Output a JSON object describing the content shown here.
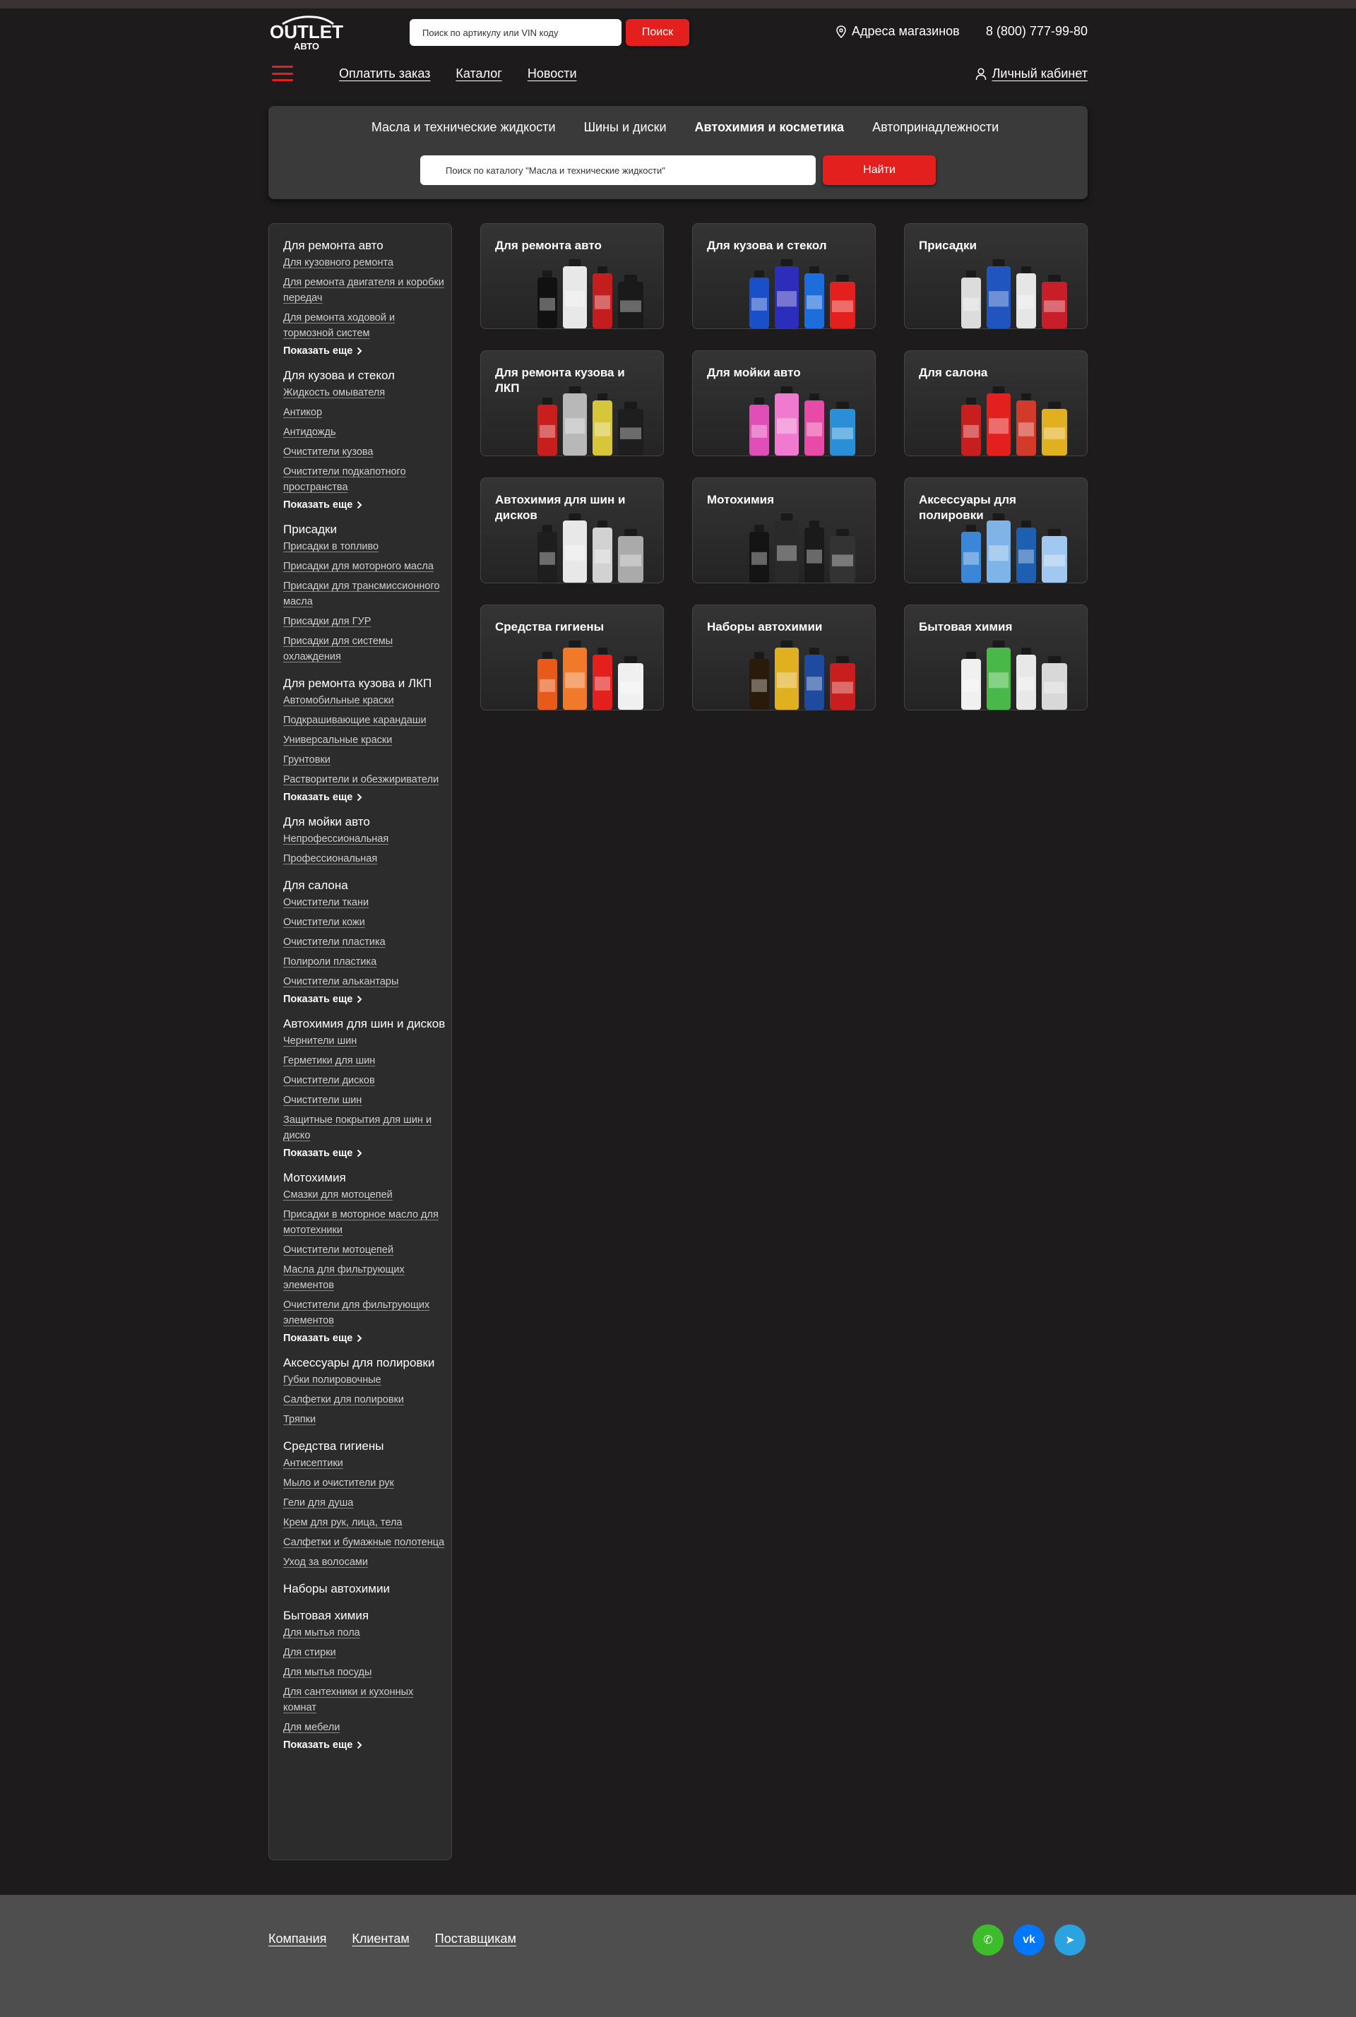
{
  "colors": {
    "accent": "#e4201f",
    "bg": "#1d1b1c",
    "panel": "#3a3a3b",
    "footer": "#4e4e4f",
    "whatsapp": "#3ebd2b",
    "vk": "#0077ff",
    "telegram": "#2aa3e0"
  },
  "header": {
    "logo_top": "OUTLET",
    "logo_bottom": "АВТО",
    "search_placeholder": "Поиск по артикулу или VIN коду",
    "search_button": "Поиск",
    "stores": "Адреса магазинов",
    "phone": "8 (800) 777-99-80"
  },
  "nav": {
    "links": [
      "Оплатить заказ",
      "Каталог",
      "Новости"
    ],
    "cabinet": "Личный кабинет"
  },
  "catalog": {
    "tabs": [
      "Масла и технические жидкости",
      "Шины и диски",
      "Автохимия и косметика",
      "Автопринадлежности"
    ],
    "active_tab": 2,
    "search_placeholder": "Поиск по каталогу \"Масла и технические жидкости\"",
    "search_button": "Найти"
  },
  "sidebar": {
    "show_more": "Показать еще",
    "groups": [
      {
        "title": "Для ремонта авто",
        "links": [
          "Для кузовного ремонта",
          "Для ремонта двигателя и коробки передач",
          "Для ремонта ходовой и тормозной систем"
        ],
        "more": true
      },
      {
        "title": "Для кузова и стекол",
        "links": [
          "Жидкость омывателя",
          "Антикор",
          "Антидождь",
          "Очистители кузова",
          "Очистители подкапотного пространства"
        ],
        "more": true
      },
      {
        "title": "Присадки",
        "links": [
          "Присадки в топливо",
          "Присадки для моторного масла",
          "Присадки для трансмиссионного масла",
          "Присадки для ГУР",
          "Присадки для системы охлаждения"
        ],
        "more": false
      },
      {
        "title": "Для ремонта кузова и ЛКП",
        "links": [
          "Автомобильные краски",
          "Подкрашивающие карандаши",
          "Универсальные краски",
          "Грунтовки",
          "Растворители и обезжириватели"
        ],
        "more": true
      },
      {
        "title": "Для мойки авто",
        "links": [
          "Непрофессиональная",
          "Профессиональная"
        ],
        "more": false
      },
      {
        "title": "Для салона",
        "links": [
          "Очистители ткани",
          "Очистители кожи",
          "Очистители пластика",
          "Полироли пластика",
          "Очистители алькантары"
        ],
        "more": true
      },
      {
        "title": "Автохимия для шин и дисков",
        "links": [
          "Чернители шин",
          "Герметики для шин",
          "Очистители дисков",
          "Очистители шин",
          "Защитные покрытия для шин и диско"
        ],
        "more": true
      },
      {
        "title": "Мотохимия",
        "links": [
          "Смазки для мотоцепей",
          "Присадки в моторное масло для мототехники",
          "Очистители мотоцепей",
          "Масла для фильтрующих элементов",
          "Очистители для фильтрующих элементов"
        ],
        "more": true
      },
      {
        "title": "Аксессуары для полировки",
        "links": [
          "Губки полировочные",
          "Салфетки для полировки",
          "Тряпки"
        ],
        "more": false
      },
      {
        "title": "Средства гигиены",
        "links": [
          "Антисептики",
          "Мыло и очистители рук",
          "Гели для душа",
          "Крем для рук, лица, тела",
          "Салфетки и бумажные полотенца",
          "Уход за волосами"
        ],
        "more": false
      },
      {
        "title": "Наборы автохимии",
        "links": [],
        "more": false
      },
      {
        "title": "Бытовая химия",
        "links": [
          "Для мытья пола",
          "Для стирки",
          "Для мытья посуды",
          "Для сантехники и кухонных комнат",
          "Для мебели"
        ],
        "more": true
      }
    ]
  },
  "cards": [
    {
      "title": "Для ремонта авто",
      "palette": [
        "#111111",
        "#e8e8e8",
        "#c41d1d",
        "#1a1a1a"
      ]
    },
    {
      "title": "Для кузова и стекол",
      "palette": [
        "#1b4fc8",
        "#2d2dbb",
        "#1e6ddc",
        "#e4201f"
      ]
    },
    {
      "title": "Присадки",
      "palette": [
        "#dcdcdc",
        "#2055c0",
        "#e6e6e6",
        "#c81e2a"
      ]
    },
    {
      "title": "Для ремонта кузова и ЛКП",
      "palette": [
        "#c81e1e",
        "#b8b8b8",
        "#d7c63a",
        "#1e1e1e"
      ]
    },
    {
      "title": "Для мойки авто",
      "palette": [
        "#e04fb8",
        "#f07ad0",
        "#e84aa8",
        "#2a8fd6"
      ]
    },
    {
      "title": "Для салона",
      "palette": [
        "#c81e1e",
        "#e4201f",
        "#d33a2a",
        "#e0b020"
      ]
    },
    {
      "title": "Автохимия для шин и дисков",
      "palette": [
        "#1e1e1e",
        "#e8e8e8",
        "#d2d2d2",
        "#aaaaaa"
      ]
    },
    {
      "title": "Мотохимия",
      "palette": [
        "#141414",
        "#2a2a2a",
        "#1a1a1a",
        "#333333"
      ]
    },
    {
      "title": "Аксессуары для полировки",
      "palette": [
        "#3a86d8",
        "#7fb4e8",
        "#1d5fb0",
        "#a0c8f0"
      ]
    },
    {
      "title": "Средства гигиены",
      "palette": [
        "#e85a1a",
        "#f07a2a",
        "#e4201f",
        "#f0f0f0"
      ]
    },
    {
      "title": "Наборы автохимии",
      "palette": [
        "#2a1a0a",
        "#e0b020",
        "#1e4aa0",
        "#c81e1e"
      ]
    },
    {
      "title": "Бытовая химия",
      "palette": [
        "#f0f0f0",
        "#48b848",
        "#e8e8e8",
        "#d8d8d8"
      ]
    }
  ],
  "footer": {
    "links": [
      "Компания",
      "Клиентам",
      "Поставщикам"
    ],
    "socials": [
      {
        "name": "whatsapp",
        "glyph": "✆"
      },
      {
        "name": "vk",
        "glyph": "vk"
      },
      {
        "name": "telegram",
        "glyph": "➤"
      }
    ]
  }
}
